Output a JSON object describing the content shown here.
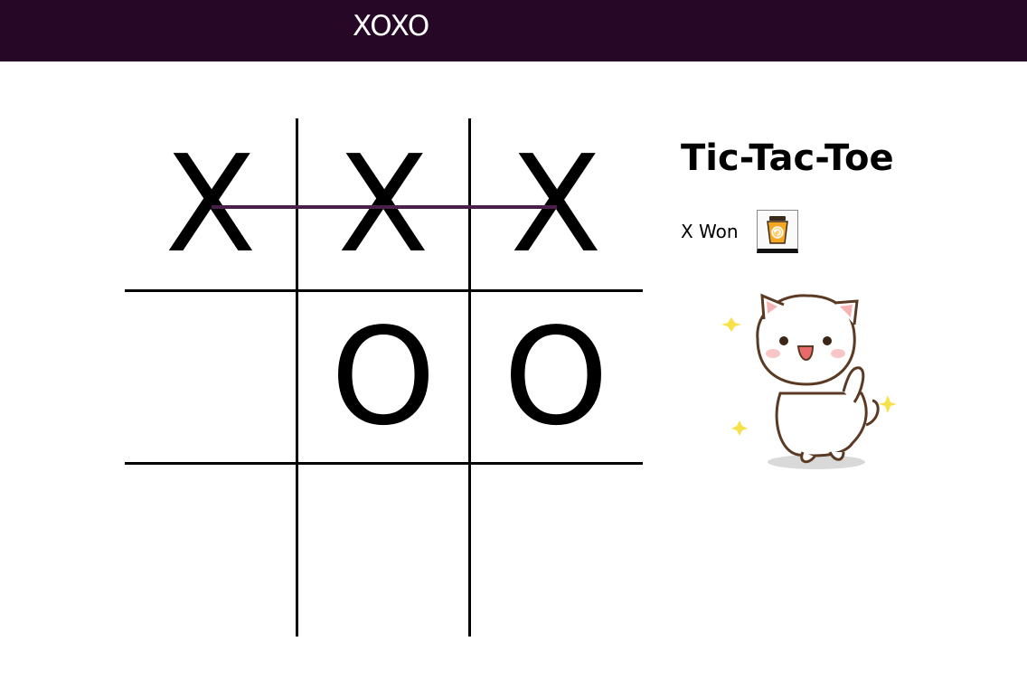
{
  "app": {
    "title": "XOXO"
  },
  "board": {
    "cells": [
      "X",
      "X",
      "X",
      "",
      "O",
      "O",
      "",
      "",
      ""
    ],
    "winning_line": [
      0,
      1,
      2
    ]
  },
  "sidebar": {
    "title": "Tic-Tac-Toe",
    "status": "X Won",
    "reset_icon": "cup-refresh-icon",
    "sticker": "cat-dancing-sticker"
  },
  "colors": {
    "topbar": "#260826",
    "win_line": "#4a1f4a",
    "grid": "#000000",
    "reset_cup": "#f5a623"
  }
}
